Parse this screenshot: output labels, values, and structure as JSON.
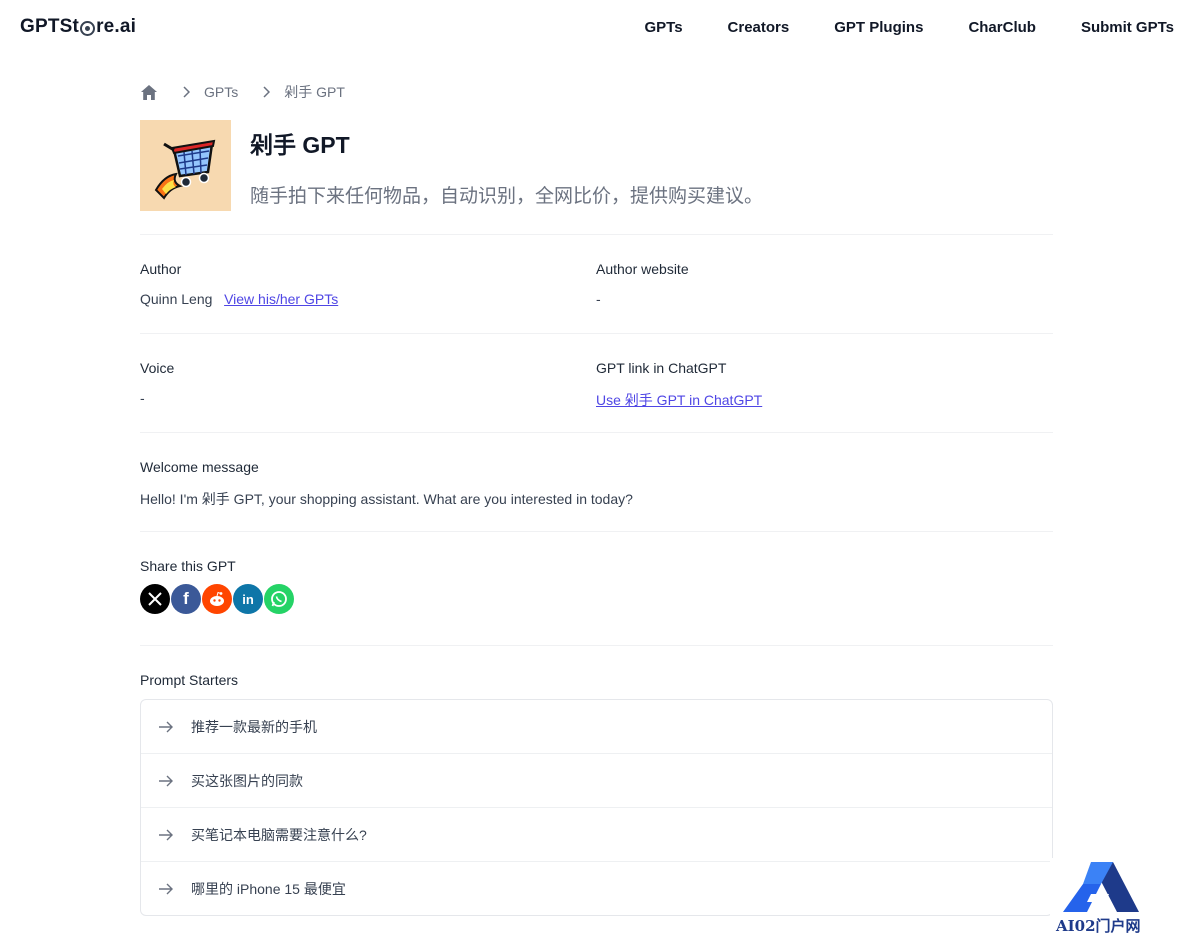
{
  "header": {
    "logo": {
      "pre": "GPTSt",
      "post": "re.ai"
    },
    "nav": [
      "GPTs",
      "Creators",
      "GPT Plugins",
      "CharClub",
      "Submit GPTs"
    ]
  },
  "breadcrumb": {
    "items": [
      "GPTs",
      "剁手 GPT"
    ]
  },
  "gpt": {
    "title": "剁手 GPT",
    "description": "随手拍下来任何物品，自动识别，全网比价，提供购买建议。"
  },
  "details": {
    "author_label": "Author",
    "author_name": "Quinn Leng",
    "author_link": "View his/her GPTs",
    "author_website_label": "Author website",
    "author_website_value": "-",
    "voice_label": "Voice",
    "voice_value": "-",
    "gpt_link_label": "GPT link in ChatGPT",
    "gpt_link_text": "Use 剁手 GPT in ChatGPT",
    "welcome_label": "Welcome message",
    "welcome_text": "Hello! I'm 剁手 GPT, your shopping assistant. What are you interested in today?"
  },
  "share": {
    "label": "Share this GPT",
    "buttons": [
      {
        "name": "x",
        "color": "#000000"
      },
      {
        "name": "facebook",
        "color": "#3b5998"
      },
      {
        "name": "reddit",
        "color": "#ff4500"
      },
      {
        "name": "linkedin",
        "color": "#0e76a8"
      },
      {
        "name": "whatsapp",
        "color": "#25d366"
      }
    ]
  },
  "prompts": {
    "label": "Prompt Starters",
    "items": [
      "推荐一款最新的手机",
      "买这张图片的同款",
      "买笔记本电脑需要注意什么?",
      "哪里的 iPhone 15 最便宜"
    ]
  },
  "watermark": {
    "text": "AI02门户网"
  },
  "colors": {
    "link": "#4f46e5",
    "thumb_bg": "#f7d9b0",
    "muted": "#6b7280"
  }
}
